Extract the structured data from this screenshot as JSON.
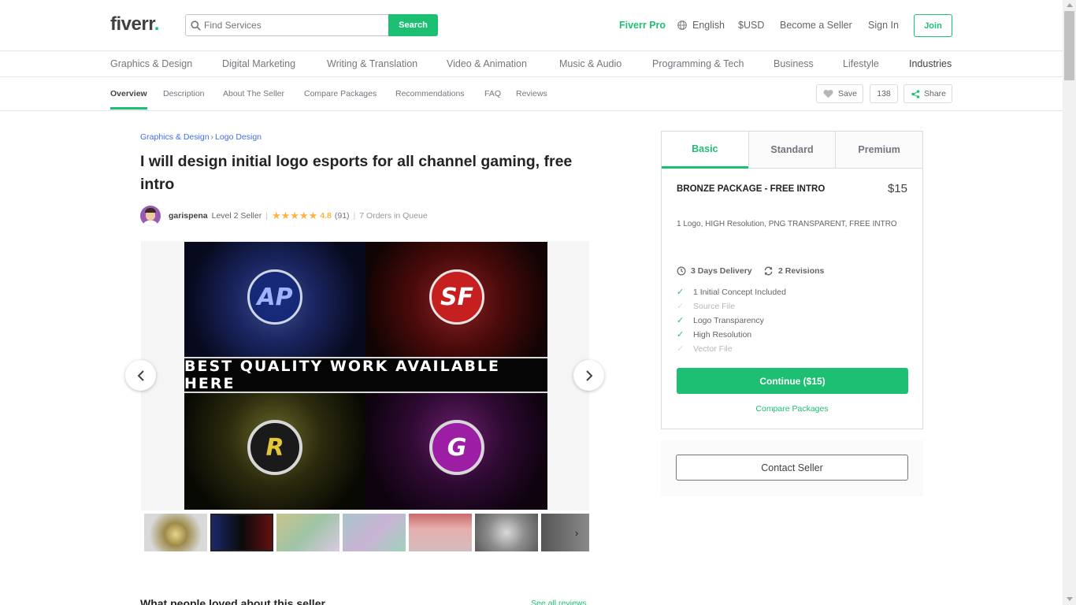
{
  "header": {
    "logo": "fiverr",
    "logo_dot": ".",
    "search_placeholder": "Find Services",
    "search_button": "Search",
    "pro": "Fiverr Pro",
    "language": "English",
    "currency": "$USD",
    "become_seller": "Become a Seller",
    "sign_in": "Sign In",
    "join": "Join"
  },
  "categories": [
    "Graphics & Design",
    "Digital Marketing",
    "Writing & Translation",
    "Video & Animation",
    "Music & Audio",
    "Programming & Tech",
    "Business",
    "Lifestyle",
    "Industries"
  ],
  "subnav": {
    "items": [
      "Overview",
      "Description",
      "About The Seller",
      "Compare Packages",
      "Recommendations",
      "FAQ",
      "Reviews"
    ],
    "save": "Save",
    "save_count": "138",
    "share": "Share"
  },
  "breadcrumb": {
    "parent": "Graphics & Design",
    "separator": "›",
    "child": "Logo Design"
  },
  "gig": {
    "title": "I will design initial logo esports for all channel gaming, free intro",
    "seller_name": "garispena",
    "seller_level": "Level 2 Seller",
    "stars": "★★★★★",
    "rating": "4.8",
    "rating_count": "(91)",
    "queue": "7 Orders in Queue",
    "banner_text": "BEST QUALITY WORK AVAILABLE HERE",
    "emblems": [
      "AP",
      "SF",
      "R",
      "G"
    ]
  },
  "package": {
    "tabs": [
      "Basic",
      "Standard",
      "Premium"
    ],
    "name": "BRONZE PACKAGE - FREE INTRO",
    "price": "$15",
    "description": "1 Logo, HIGH Resolution, PNG TRANSPARENT, FREE INTRO",
    "delivery": "3 Days Delivery",
    "revisions": "2 Revisions",
    "features": [
      {
        "label": "1 Initial Concept Included",
        "included": true
      },
      {
        "label": "Source File",
        "included": false
      },
      {
        "label": "Logo Transparency",
        "included": true
      },
      {
        "label": "High Resolution",
        "included": true
      },
      {
        "label": "Vector File",
        "included": false
      }
    ],
    "check_mark": "✓",
    "continue": "Continue ($15)",
    "compare": "Compare Packages",
    "contact": "Contact Seller"
  },
  "reviews": {
    "heading": "What people loved about this seller",
    "see_all": "See all reviews"
  },
  "colors": {
    "brand_green": "#1dbf73",
    "link_blue": "#446ee7",
    "star_yellow": "#ffb33e"
  }
}
